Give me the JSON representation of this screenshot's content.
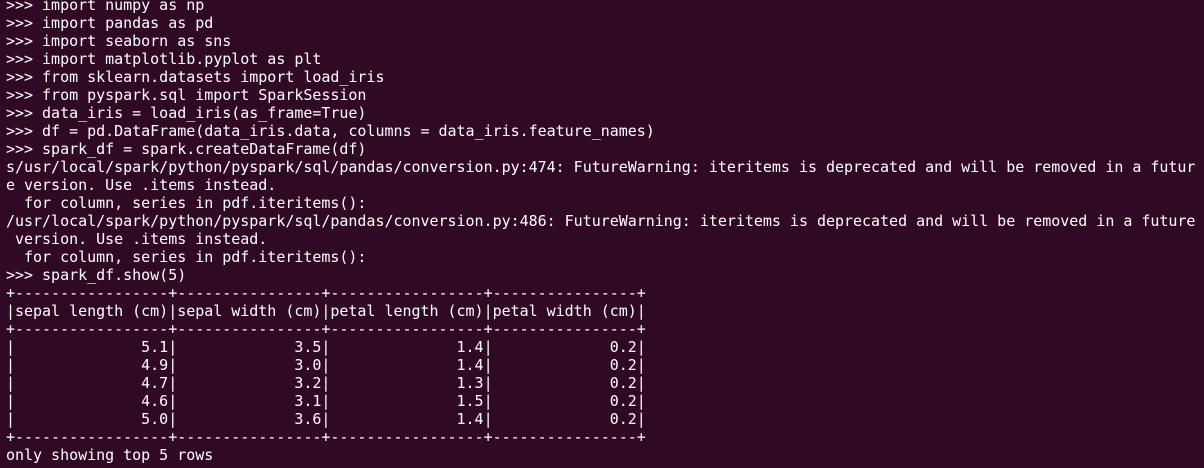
{
  "terminal": {
    "lines": [
      ">>> import numpy as np",
      ">>> import pandas as pd",
      ">>> import seaborn as sns",
      ">>> import matplotlib.pyplot as plt",
      ">>> from sklearn.datasets import load_iris",
      ">>> from pyspark.sql import SparkSession",
      ">>> data_iris = load_iris(as_frame=True)",
      ">>> df = pd.DataFrame(data_iris.data, columns = data_iris.feature_names)",
      ">>> spark_df = spark.createDataFrame(df)",
      "s/usr/local/spark/python/pyspark/sql/pandas/conversion.py:474: FutureWarning: iteritems is deprecated and will be removed in a futur",
      "e version. Use .items instead.",
      "  for column, series in pdf.iteritems():",
      "/usr/local/spark/python/pyspark/sql/pandas/conversion.py:486: FutureWarning: iteritems is deprecated and will be removed in a future",
      " version. Use .items instead.",
      "  for column, series in pdf.iteritems():",
      ">>> spark_df.show(5)",
      "+-----------------+----------------+-----------------+----------------+",
      "|sepal length (cm)|sepal width (cm)|petal length (cm)|petal width (cm)|",
      "+-----------------+----------------+-----------------+----------------+",
      "|              5.1|             3.5|              1.4|             0.2|",
      "|              4.9|             3.0|              1.4|             0.2|",
      "|              4.7|             3.2|              1.3|             0.2|",
      "|              4.6|             3.1|              1.5|             0.2|",
      "|              5.0|             3.6|              1.4|             0.2|",
      "+-----------------+----------------+-----------------+----------------+",
      "only showing top 5 rows"
    ],
    "colors": {
      "background": "#300a24",
      "text": "#ffffff"
    }
  }
}
